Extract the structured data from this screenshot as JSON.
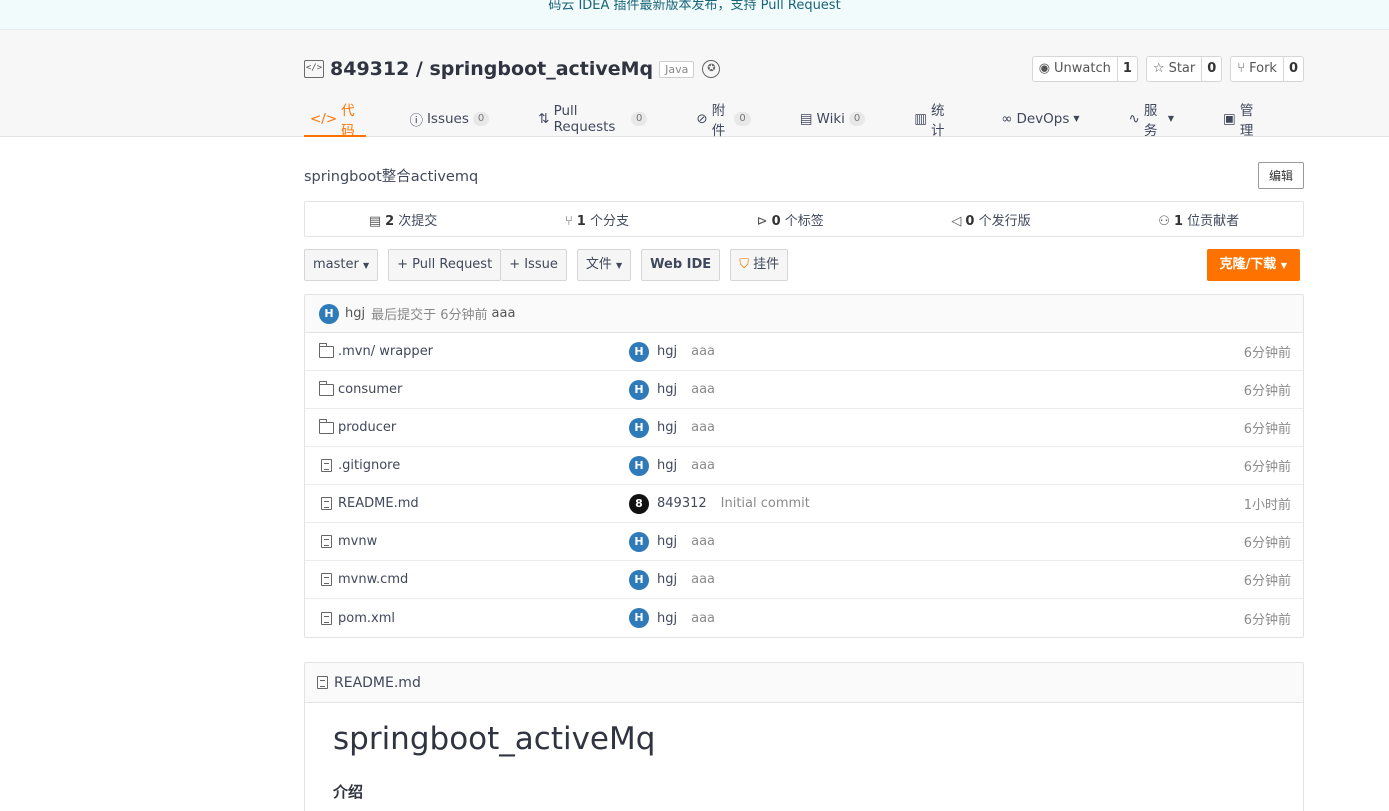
{
  "banner": {
    "text": "码云 IDEA 插件最新版本发布，支持 Pull Request"
  },
  "repo": {
    "title": "849312 / springboot_activeMq",
    "language": "Java",
    "description": "springboot整合activemq",
    "edit_label": "编辑"
  },
  "actions": [
    {
      "label": "Unwatch",
      "count": "1",
      "icon": "eye-icon"
    },
    {
      "label": "Star",
      "count": "0",
      "icon": "star-icon"
    },
    {
      "label": "Fork",
      "count": "0",
      "icon": "fork-icon"
    }
  ],
  "tabs": [
    {
      "label": "代码",
      "icon": "code-icon",
      "active": true
    },
    {
      "label": "Issues",
      "badge": "0",
      "icon": "issue-icon"
    },
    {
      "label": "Pull Requests",
      "badge": "0",
      "icon": "pull-request-icon"
    },
    {
      "label": "附件",
      "badge": "0",
      "icon": "attachment-icon"
    },
    {
      "label": "Wiki",
      "badge": "0",
      "icon": "wiki-icon"
    },
    {
      "label": "统计",
      "icon": "chart-icon"
    },
    {
      "label": "DevOps",
      "icon": "devops-icon",
      "dropdown": true
    },
    {
      "label": "服务",
      "icon": "service-icon",
      "dropdown": true
    },
    {
      "label": "管理",
      "icon": "manage-icon"
    }
  ],
  "stats": [
    {
      "count": "2",
      "label": " 次提交",
      "icon": "commit-icon"
    },
    {
      "count": "1",
      "label": " 个分支",
      "icon": "branch-icon"
    },
    {
      "count": "0",
      "label": " 个标签",
      "icon": "tag-icon"
    },
    {
      "count": "0",
      "label": " 个发行版",
      "icon": "release-icon"
    },
    {
      "count": "1",
      "label": " 位贡献者",
      "icon": "contributor-icon"
    }
  ],
  "toolbar": {
    "branch": "master",
    "new_pr": "+ Pull Request",
    "new_issue": "+ Issue",
    "file_menu": "文件",
    "web_ide": "Web IDE",
    "widget": "挂件",
    "clone": "克隆/下载"
  },
  "last_commit": {
    "avatar": "H",
    "author": "hgj",
    "text": "最后提交于 6分钟前",
    "message": "aaa"
  },
  "files": [
    {
      "name": ".mvn/ wrapper",
      "type": "folder",
      "avatar": "H",
      "author": "hgj",
      "message": "aaa",
      "time": "6分钟前"
    },
    {
      "name": "consumer",
      "type": "folder",
      "avatar": "H",
      "author": "hgj",
      "message": "aaa",
      "time": "6分钟前"
    },
    {
      "name": "producer",
      "type": "folder",
      "avatar": "H",
      "author": "hgj",
      "message": "aaa",
      "time": "6分钟前"
    },
    {
      "name": ".gitignore",
      "type": "file",
      "avatar": "H",
      "author": "hgj",
      "message": "aaa",
      "time": "6分钟前"
    },
    {
      "name": "README.md",
      "type": "file",
      "avatar": "8",
      "author": "849312",
      "message": "Initial commit",
      "time": "1小时前"
    },
    {
      "name": "mvnw",
      "type": "file",
      "avatar": "H",
      "author": "hgj",
      "message": "aaa",
      "time": "6分钟前"
    },
    {
      "name": "mvnw.cmd",
      "type": "file",
      "avatar": "H",
      "author": "hgj",
      "message": "aaa",
      "time": "6分钟前"
    },
    {
      "name": "pom.xml",
      "type": "file",
      "avatar": "H",
      "author": "hgj",
      "message": "aaa",
      "time": "6分钟前"
    }
  ],
  "readme": {
    "filename": "README.md",
    "heading": "springboot_activeMq",
    "subheading": "介绍"
  },
  "colors": {
    "accent": "#fe7300",
    "avatar": "#2f7ab8"
  }
}
